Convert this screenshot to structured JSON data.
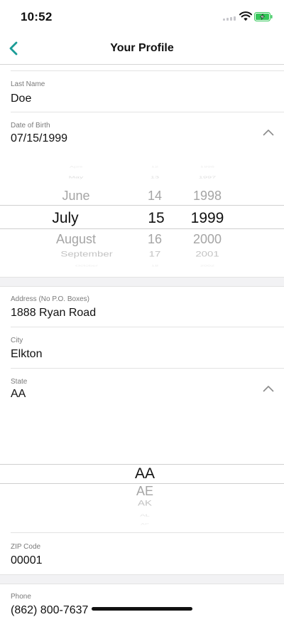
{
  "status_bar": {
    "time": "10:52"
  },
  "nav": {
    "title": "Your Profile",
    "back_icon": "chevron-left-icon",
    "accent": "#1b9c97"
  },
  "fields": {
    "last_name": {
      "label": "Last Name",
      "value": "Doe"
    },
    "dob": {
      "label": "Date of Birth",
      "value": "07/15/1999"
    },
    "address": {
      "label": "Address (No P.O. Boxes)",
      "value": "1888 Ryan Road"
    },
    "city": {
      "label": "City",
      "value": "Elkton"
    },
    "state": {
      "label": "State",
      "value": "AA"
    },
    "zip": {
      "label": "ZIP Code",
      "value": "00001"
    },
    "phone": {
      "label": "Phone",
      "value": "(862) 800-7637"
    }
  },
  "date_picker": {
    "month": {
      "before": [
        "April",
        "May",
        "June"
      ],
      "selected": "July",
      "after": [
        "August",
        "September",
        "October"
      ]
    },
    "day": {
      "before": [
        "12",
        "13",
        "14"
      ],
      "selected": "15",
      "after": [
        "16",
        "17",
        "18"
      ]
    },
    "year": {
      "before": [
        "1996",
        "1997",
        "1998"
      ],
      "selected": "1999",
      "after": [
        "2000",
        "2001",
        "2002"
      ]
    }
  },
  "state_picker": {
    "selected": "AA",
    "after": [
      "AE",
      "AK",
      "AL",
      "AP"
    ]
  }
}
